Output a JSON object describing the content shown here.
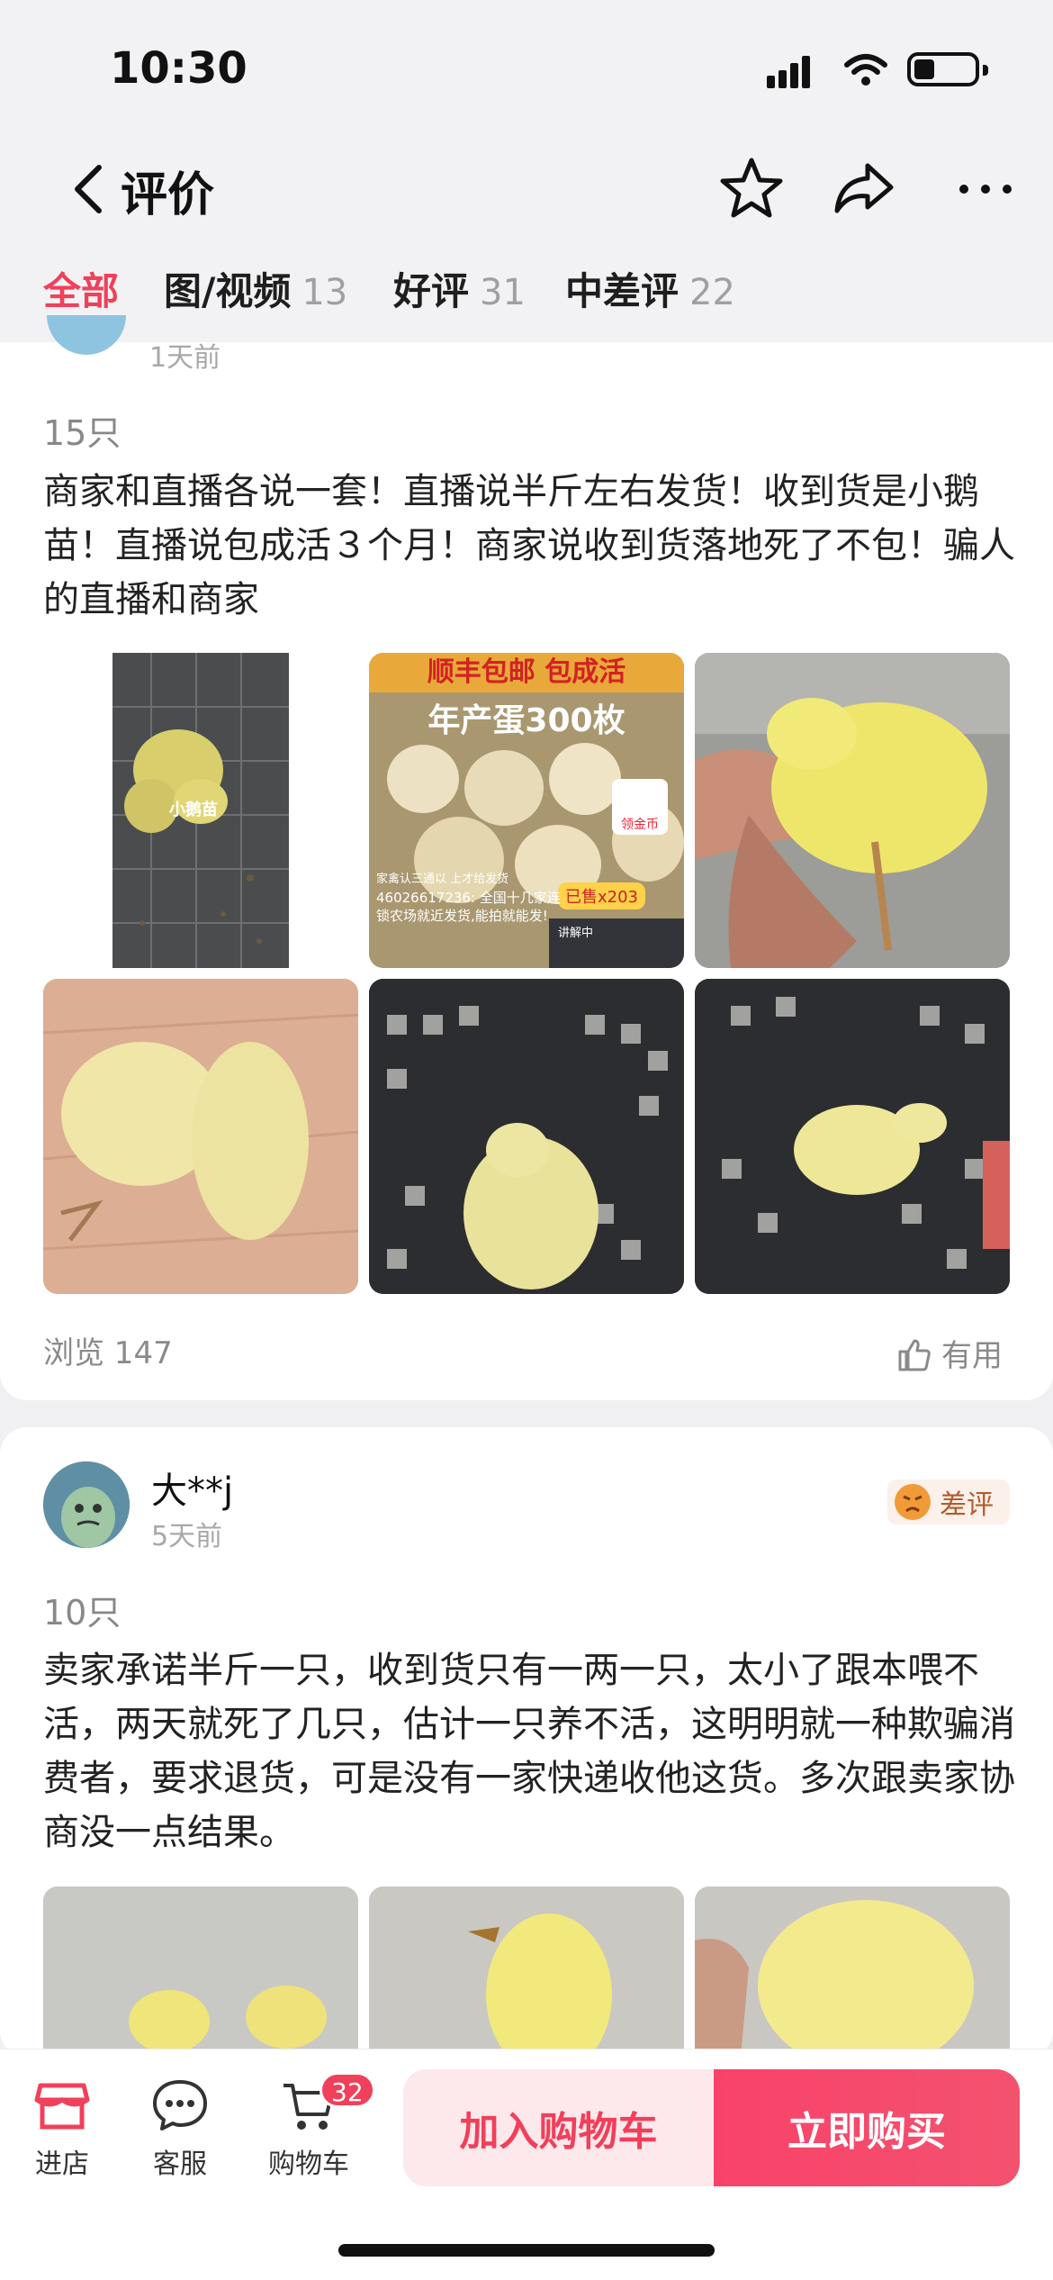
{
  "status_bar": {
    "time": "10:30"
  },
  "header": {
    "title": "评价"
  },
  "tabs": [
    {
      "label": "全部",
      "count": ""
    },
    {
      "label": "图/视频",
      "count": "13"
    },
    {
      "label": "好评",
      "count": "31"
    },
    {
      "label": "中差评",
      "count": "22"
    }
  ],
  "review1": {
    "date": "1天前",
    "quantity": "15只",
    "text": "商家和直播各说一套！直播说半斤左右发货！收到货是小鹅苗！直播说包成活３个月！商家说收到货落地死了不包！骗人的直播和商家",
    "image_texts": {
      "img1_label": "小鹅苗",
      "img2_banner": "顺丰包邮 包成活",
      "img2_headline": "年产蛋300枚",
      "img2_coin": "领金币",
      "img2_sold": "已售x203",
      "img2_line1": "家禽认三通以 上才给发货",
      "img2_line2": "46026617236: 全国十几家连锁农场就近发货,能拍就能发!",
      "img2_live": "讲解中"
    },
    "views": "浏览 147",
    "useful": "有用"
  },
  "review2": {
    "username": "大**j",
    "date": "5天前",
    "badge": "差评",
    "quantity": "10只",
    "text": "卖家承诺半斤一只，收到货只有一两一只，太小了跟本喂不活，两天就死了几只，估计一只养不活，这明明就一种欺骗消费者，要求退货，可是没有一家快递收他这货。多次跟卖家协商没一点结果。"
  },
  "bottom_bar": {
    "store": "进店",
    "service": "客服",
    "cart": "购物车",
    "cart_count": "32",
    "add_to_cart": "加入购物车",
    "buy_now": "立即购买"
  },
  "colors": {
    "accent": "#f0405a",
    "muted": "#a0a0a0"
  }
}
